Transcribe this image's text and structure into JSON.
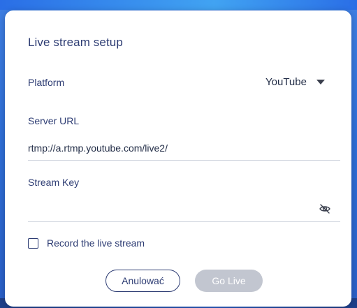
{
  "dialog": {
    "title": "Live stream setup"
  },
  "platform": {
    "label": "Platform",
    "selected": "YouTube",
    "dropdown_icon": "chevron-down-icon"
  },
  "server_url": {
    "label": "Server URL",
    "value": "rtmp://a.rtmp.youtube.com/live2/"
  },
  "stream_key": {
    "label": "Stream Key",
    "value": "",
    "visibility_icon": "eye-off-icon"
  },
  "record": {
    "label": "Record the live stream",
    "checked": false
  },
  "buttons": {
    "cancel_label": "Anulować",
    "go_live_label": "Go Live",
    "go_live_enabled": false
  },
  "colors": {
    "accent": "#2d3c73",
    "disabled_button": "#c2c6d0",
    "background": "#2f6fd8",
    "divider": "#cfd4de"
  }
}
